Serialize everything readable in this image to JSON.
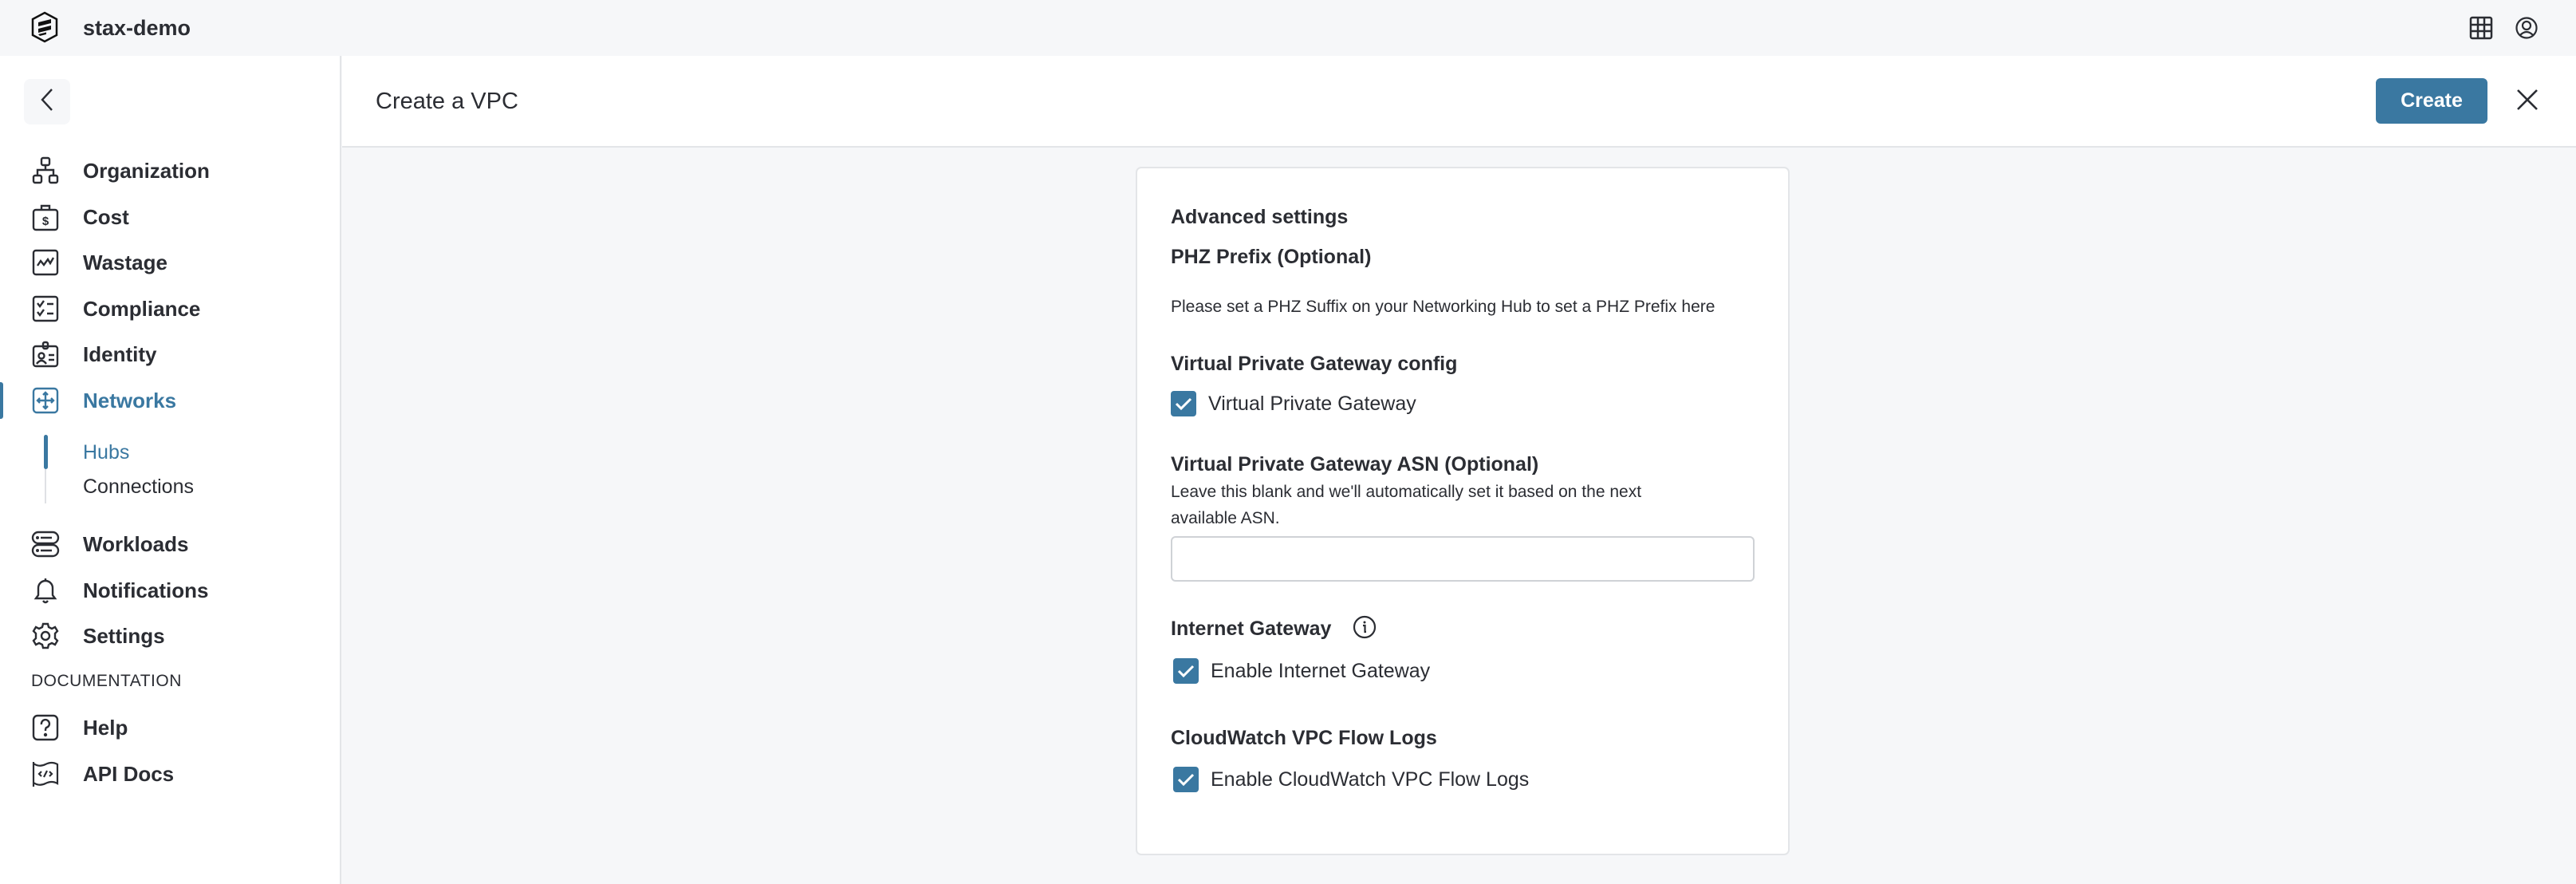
{
  "topbar": {
    "org_name": "stax-demo",
    "icons": [
      "stax-logo-icon",
      "app-grid-icon",
      "user-account-icon"
    ]
  },
  "sidebar": {
    "back_icon": "chevron-left-icon",
    "items": [
      {
        "label": "Organization",
        "icon": "org-chart-icon",
        "active": false
      },
      {
        "label": "Cost",
        "icon": "cost-dollar-icon",
        "active": false
      },
      {
        "label": "Wastage",
        "icon": "wastage-chart-icon",
        "active": false
      },
      {
        "label": "Compliance",
        "icon": "checklist-icon",
        "active": false
      },
      {
        "label": "Identity",
        "icon": "id-badge-icon",
        "active": false
      },
      {
        "label": "Networks",
        "icon": "networks-arrows-icon",
        "active": true
      },
      {
        "label": "Workloads",
        "icon": "server-stack-icon",
        "active": false
      },
      {
        "label": "Notifications",
        "icon": "bell-icon",
        "active": false
      },
      {
        "label": "Settings",
        "icon": "gear-icon",
        "active": false
      }
    ],
    "sub_items": [
      {
        "label": "Hubs",
        "active": true
      },
      {
        "label": "Connections",
        "active": false
      }
    ],
    "doc_section_label": "DOCUMENTATION",
    "doc_items": [
      {
        "label": "Help",
        "icon": "help-question-icon"
      },
      {
        "label": "API Docs",
        "icon": "api-docs-code-icon"
      }
    ]
  },
  "header": {
    "title": "Create a VPC",
    "create_label": "Create",
    "close_icon": "close-icon"
  },
  "form": {
    "section_title": "Advanced settings",
    "phz": {
      "label": "PHZ Prefix (Optional)",
      "help": "Please set a PHZ Suffix on your Networking Hub to set a PHZ Prefix here"
    },
    "vpg_config": {
      "label": "Virtual Private Gateway config",
      "checkbox_label": "Virtual Private Gateway",
      "checked": true
    },
    "vpg_asn": {
      "label": "Virtual Private Gateway ASN (Optional)",
      "help_line1": "Leave this blank and we'll automatically set it based on the next",
      "help_line2": "available ASN.",
      "value": "",
      "placeholder": ""
    },
    "internet_gateway": {
      "label": "Internet Gateway",
      "info_icon": "info-icon",
      "checkbox_label": "Enable Internet Gateway",
      "checked": true
    },
    "flow_logs": {
      "label": "CloudWatch VPC Flow Logs",
      "checkbox_label": "Enable CloudWatch VPC Flow Logs",
      "checked": true
    }
  },
  "colors": {
    "accent": "#3a78a1",
    "text": "#2b2d33",
    "background": "#f6f7f9",
    "border": "#e3e5e8"
  }
}
